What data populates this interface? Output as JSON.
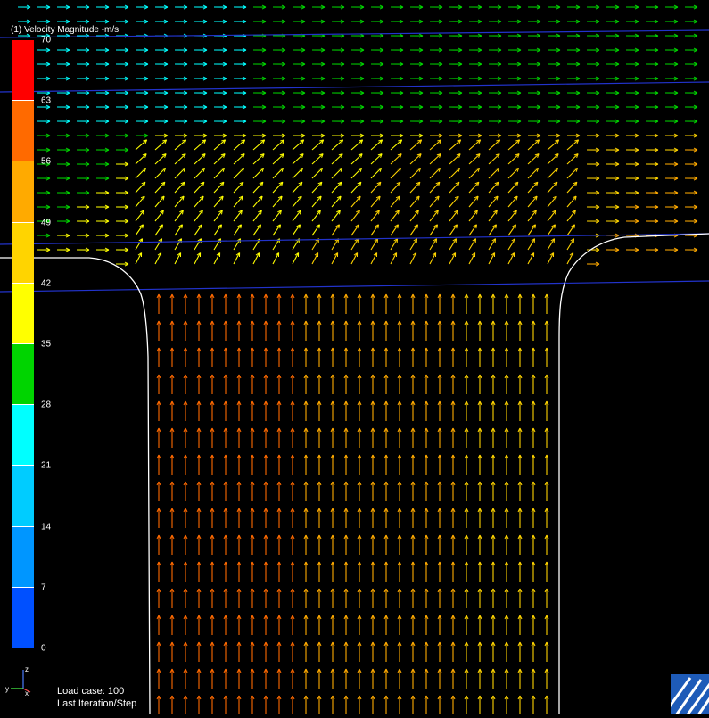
{
  "legend": {
    "title": "(1) Velocity Magnitude -m/s",
    "ticks": [
      "70",
      "63",
      "56",
      "49",
      "42",
      "35",
      "28",
      "21",
      "14",
      "7",
      "0"
    ],
    "colors": [
      "#ff0000",
      "#ff6a00",
      "#ffaa00",
      "#ffd400",
      "#ffff00",
      "#00d400",
      "#00ffff",
      "#00ccff",
      "#0096ff",
      "#0050ff",
      "#0000ff"
    ]
  },
  "status": {
    "load_case": "Load case: 100",
    "step": "Last Iteration/Step"
  },
  "triad": {
    "z_label": "z",
    "y_label": "y",
    "x_label": "x"
  },
  "view": {
    "background": "#000000",
    "outline_color": "#ffffff",
    "section_line_color": "#2233cc",
    "vector_field_icon": "velocity-arrows"
  }
}
